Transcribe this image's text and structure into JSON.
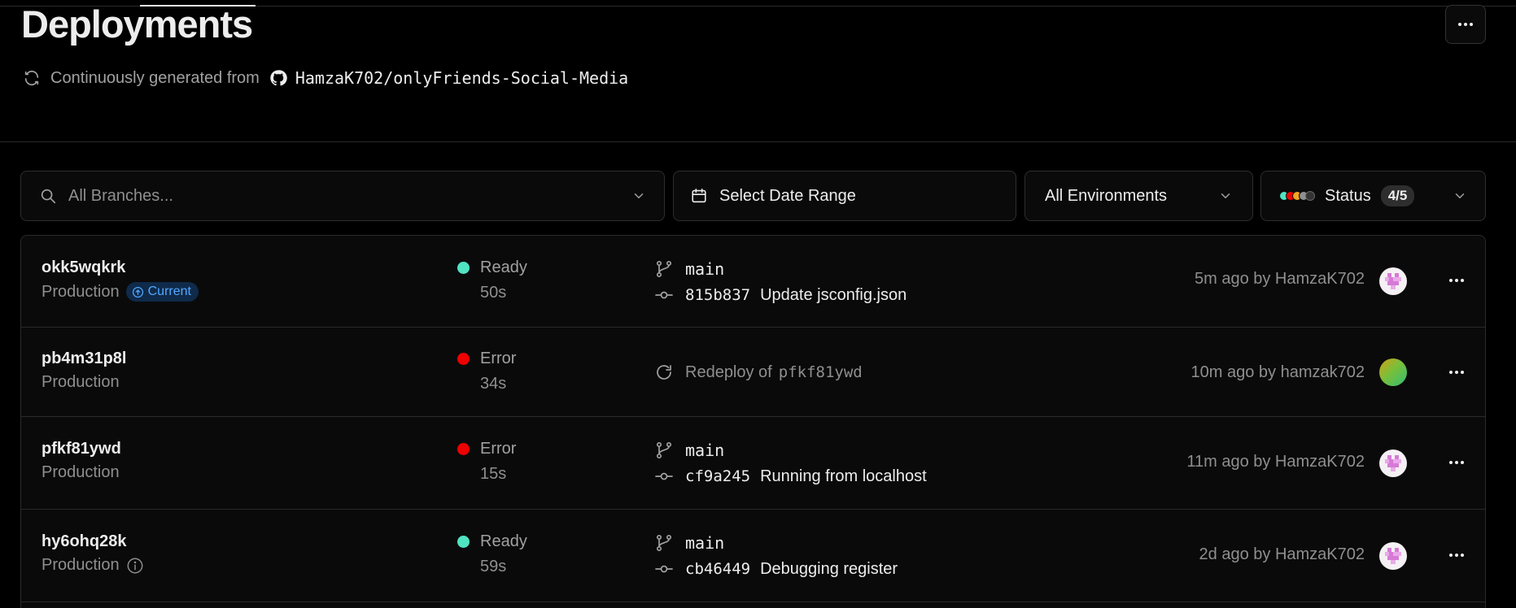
{
  "page": {
    "title": "Deployments",
    "subtitle_prefix": "Continuously generated from",
    "repo": "HamzaK702/onlyFriends-Social-Media"
  },
  "filters": {
    "branch_placeholder": "All Branches...",
    "date_label": "Select Date Range",
    "env_label": "All Environments",
    "status_label": "Status",
    "status_count": "4/5",
    "status_colors": [
      "#50e3c2",
      "#ee0000",
      "#f5a623",
      "#8f8f8f",
      "#333333"
    ]
  },
  "colors": {
    "ready": "#50e3c2",
    "error": "#ee0000",
    "current_badge": "#52a8ff"
  },
  "deployments": [
    {
      "id": "okk5wqkrk",
      "environment": "Production",
      "current_label": "Current",
      "status": "Ready",
      "duration": "50s",
      "branch": "main",
      "sha": "815b837",
      "message": "Update jsconfig.json",
      "meta": "5m ago by HamzaK702"
    },
    {
      "id": "pb4m31p8l",
      "environment": "Production",
      "status": "Error",
      "duration": "34s",
      "redeploy_prefix": "Redeploy of",
      "redeploy_of": "pfkf81ywd",
      "meta": "10m ago by hamzak702"
    },
    {
      "id": "pfkf81ywd",
      "environment": "Production",
      "status": "Error",
      "duration": "15s",
      "branch": "main",
      "sha": "cf9a245",
      "message": "Running from localhost",
      "meta": "11m ago by HamzaK702"
    },
    {
      "id": "hy6ohq28k",
      "environment": "Production",
      "status": "Ready",
      "duration": "59s",
      "branch": "main",
      "sha": "cb46449",
      "message": "Debugging register",
      "meta": "2d ago by HamzaK702"
    }
  ]
}
